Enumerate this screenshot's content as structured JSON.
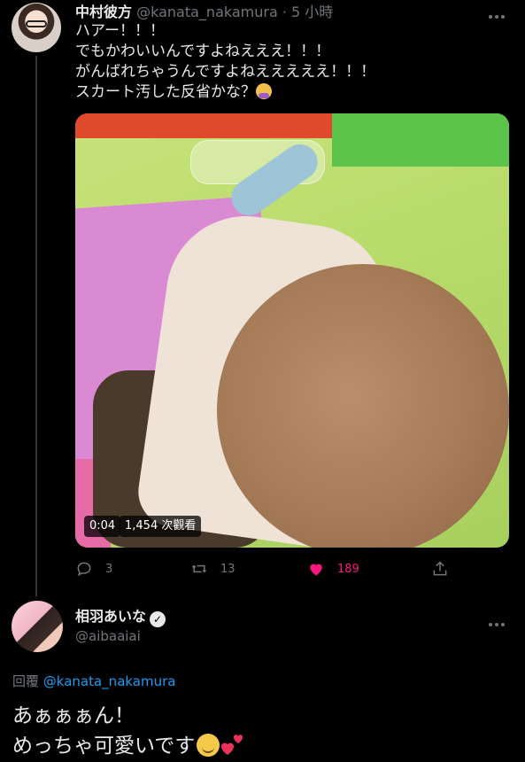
{
  "tweet1": {
    "name": "中村彼方",
    "handle": "@kanata_nakamura",
    "time": "· 5 小時",
    "lines": [
      "ハアー！！！",
      "でもかわいいんですよねえええ！！！",
      "がんばれちゃうんですよねえええええ！！！",
      "スカート汚した反省かな？"
    ],
    "video": {
      "duration": "0:04",
      "views": "1,454 次觀看"
    },
    "actions": {
      "reply_count": "3",
      "retweet_count": "13",
      "like_count": "189"
    },
    "colors": {
      "like": "#f91880",
      "muted": "#71767b",
      "link": "#1d9bf0"
    }
  },
  "tweet2": {
    "name": "相羽あいな",
    "handle": "@aibaaiai",
    "reply_prefix": "回覆",
    "reply_to": "@kanata_nakamura",
    "line1": "あぁぁぁん！",
    "line2": "めっちゃ可愛いです"
  },
  "icons": [
    "more-icon",
    "reply-icon",
    "retweet-icon",
    "heart-icon",
    "share-icon",
    "verified-badge-icon",
    "emoji-face-icon",
    "emoji-hearts-icon"
  ]
}
